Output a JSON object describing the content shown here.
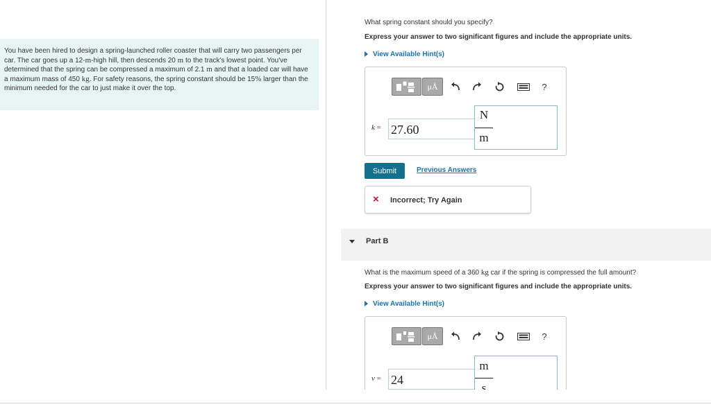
{
  "problem": {
    "text_parts": [
      "You have been hired to design a spring-launched roller coaster that will carry two passengers per car. The car goes up a 12-",
      "m",
      "-high hill, then descends 20 ",
      "m",
      " to the track's lowest point. You've determined that the spring can be compressed a maximum of 2.1 ",
      "m",
      " and that a loaded car will have a maximum mass of 450 ",
      "kg",
      ". For safety reasons, the spring constant should be 15",
      "%",
      " larger than the minimum needed for the car to just make it over the top."
    ]
  },
  "part_a": {
    "question": "What spring constant should you specify?",
    "instruction": "Express your answer to two significant figures and include the appropriate units.",
    "hint_label": "View Available Hint(s)",
    "toolbar": {
      "units_label": "μÅ",
      "help_label": "?"
    },
    "variable": "k",
    "equals": "=",
    "value": "27.60",
    "unit_numerator": "N",
    "unit_denominator": "m",
    "submit_label": "Submit",
    "previous_answers_label": "Previous Answers",
    "feedback_icon": "×",
    "feedback": "Incorrect; Try Again"
  },
  "part_b": {
    "title": "Part B",
    "question_parts": [
      "What is the maximum speed of a 360 ",
      "kg",
      " car if the spring is compressed the full amount?"
    ],
    "instruction": "Express your answer to two significant figures and include the appropriate units.",
    "hint_label": "View Available Hint(s)",
    "toolbar": {
      "units_label": "μÅ",
      "help_label": "?"
    },
    "variable": "v",
    "equals": "=",
    "value": "24",
    "unit_numerator": "m",
    "unit_denominator": "s"
  },
  "colors": {
    "accent": "#13708f",
    "link": "#1a73a8",
    "error": "#c0142a",
    "problem_bg": "#e8f4f4"
  }
}
